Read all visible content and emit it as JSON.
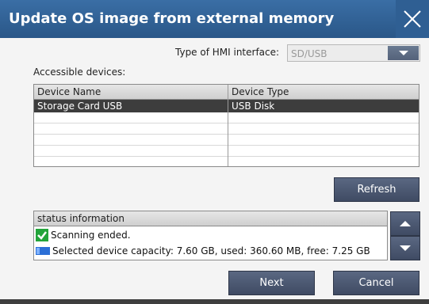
{
  "window": {
    "title": "Update OS image from external memory"
  },
  "interface": {
    "label": "Type of HMI interface:",
    "selected_value": "SD/USB"
  },
  "devices": {
    "label": "Accessible devices:",
    "columns": [
      "Device Name",
      "Device Type"
    ],
    "rows": [
      {
        "name": "Storage Card USB",
        "type": "USB Disk",
        "selected": true
      }
    ]
  },
  "buttons": {
    "refresh": "Refresh",
    "next": "Next",
    "cancel": "Cancel"
  },
  "status": {
    "header": "status information",
    "lines": [
      {
        "icon": "check-icon",
        "text": "Scanning ended."
      },
      {
        "icon": "drive-icon",
        "text": "Selected device capacity: 7.60 GB, used: 360.60 MB, free: 7.25 GB"
      }
    ]
  },
  "colors": {
    "titlebar": "#2f5f93",
    "selected_row": "#3d3d3d",
    "button": "#4c5972",
    "check": "#22a43a",
    "drive": "#2b6fd6"
  }
}
